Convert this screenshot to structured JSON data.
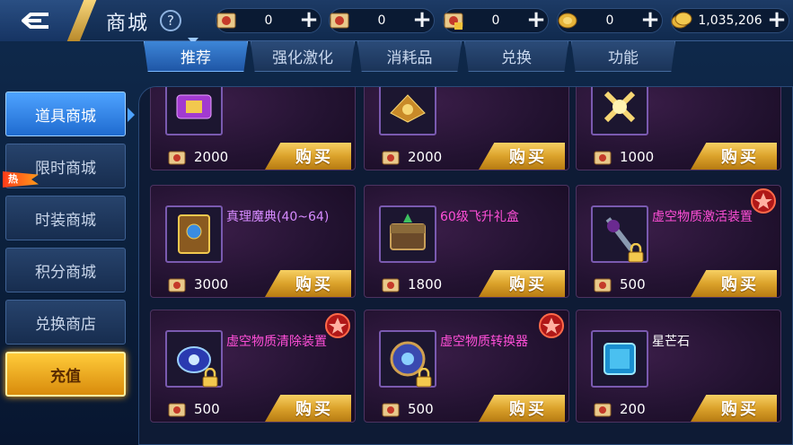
{
  "header": {
    "title": "商城",
    "help_label": "?"
  },
  "currencies": [
    {
      "icon": "scroll-token-icon",
      "value": "0"
    },
    {
      "icon": "scroll-token-icon",
      "value": "0"
    },
    {
      "icon": "locked-scroll-token-icon",
      "value": "0"
    },
    {
      "icon": "gold-coin-icon",
      "value": "0"
    },
    {
      "icon": "gold-coins-icon",
      "value": "1,035,206"
    }
  ],
  "tabs": [
    {
      "label": "推荐",
      "active": true
    },
    {
      "label": "强化激化",
      "active": false
    },
    {
      "label": "消耗品",
      "active": false
    },
    {
      "label": "兑换",
      "active": false
    },
    {
      "label": "功能",
      "active": false
    }
  ],
  "sidebar": {
    "items": [
      {
        "label": "道具商城",
        "active": true
      },
      {
        "label": "限时商城",
        "hot": "热"
      },
      {
        "label": "时装商城"
      },
      {
        "label": "积分商城"
      },
      {
        "label": "兑换商店"
      }
    ],
    "recharge_label": "充值"
  },
  "buy_label": "购买",
  "items": [
    {
      "name": "",
      "price": "2000",
      "color": "#ffffff"
    },
    {
      "name": "",
      "price": "2000",
      "color": "#ffffff"
    },
    {
      "name": "",
      "price": "1000",
      "color": "#ffffff"
    },
    {
      "name": "真理魔典(40~64)",
      "price": "3000",
      "color": "#d68bff"
    },
    {
      "name": "60级飞升礼盒",
      "price": "1800",
      "color": "#ff4fd8"
    },
    {
      "name": "虚空物质激活装置",
      "price": "500",
      "color": "#ff4fd8",
      "locked": true,
      "badge": true
    },
    {
      "name": "虚空物质清除装置",
      "price": "500",
      "color": "#ff4fd8",
      "locked": true,
      "badge": true
    },
    {
      "name": "虚空物质转换器",
      "price": "500",
      "color": "#ff4fd8",
      "locked": true,
      "badge": true
    },
    {
      "name": "星芒石",
      "price": "200",
      "color": "#ffffff"
    }
  ]
}
